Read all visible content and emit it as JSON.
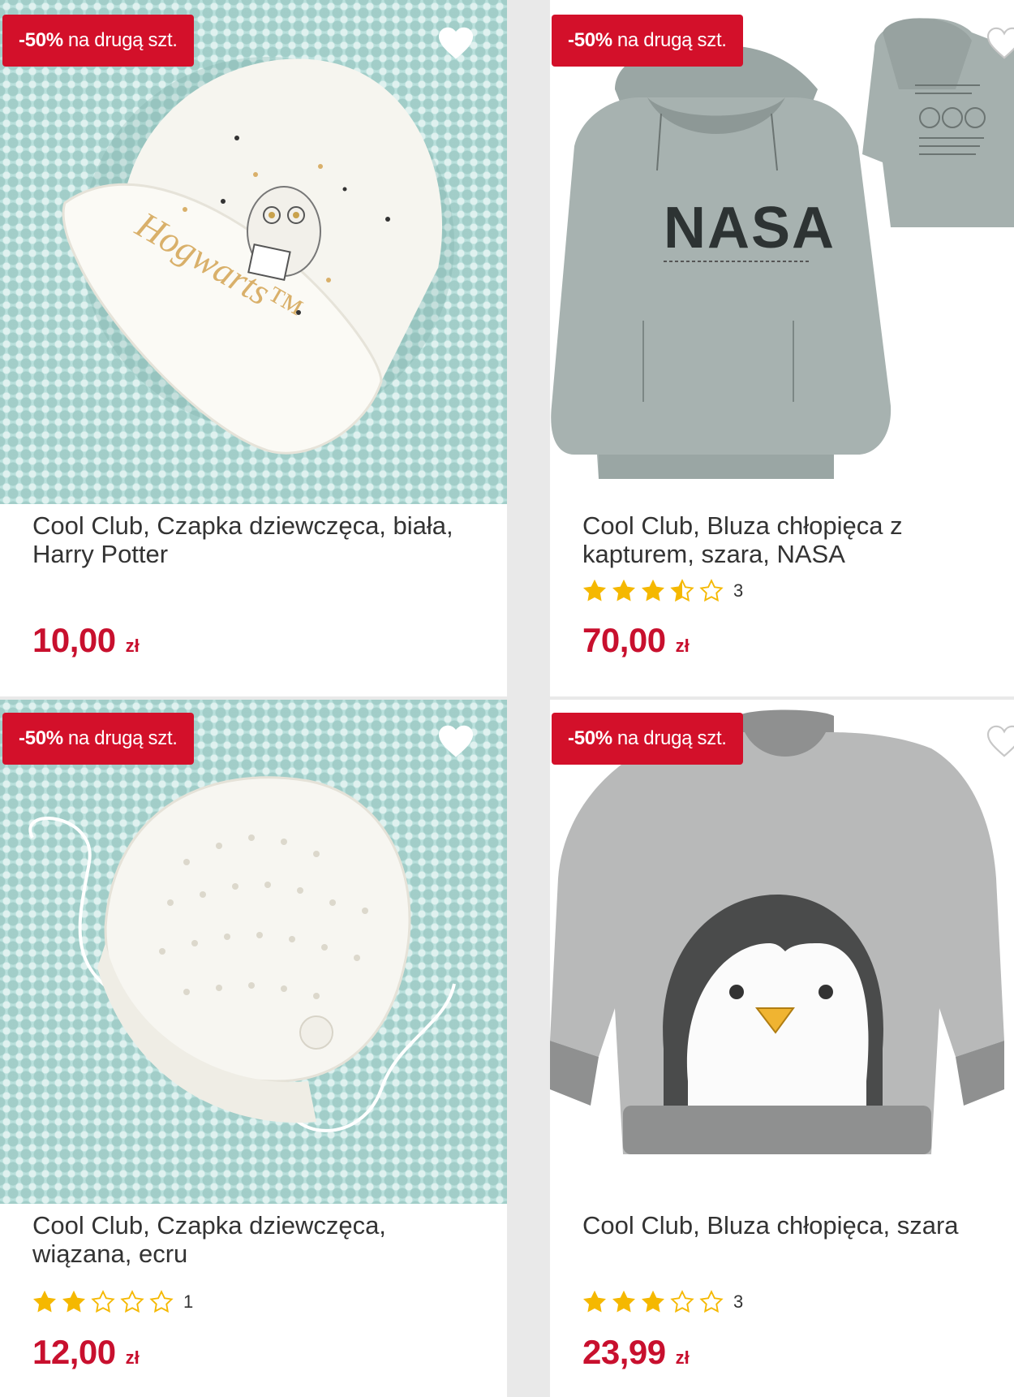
{
  "colors": {
    "accent": "#d3102a",
    "price": "#c8102e",
    "star": "#f5b800"
  },
  "products": [
    {
      "badge": {
        "pct": "-50%",
        "rest": "na drugą szt."
      },
      "title": "Cool Club, Czapka dziewczęca, biała, Harry Potter",
      "print_text": "Hogwarts™",
      "rating": null,
      "price": "10,00",
      "currency": "zł",
      "favorite_icon": "heart-icon"
    },
    {
      "badge": {
        "pct": "-50%",
        "rest": "na drugą szt."
      },
      "title": "Cool Club, Bluza chłopięca z kapturem, szara, NASA",
      "print_text": "NASA",
      "rating": {
        "stars": 3.5,
        "count": "3"
      },
      "price": "70,00",
      "currency": "zł",
      "favorite_icon": "heart-icon"
    },
    {
      "badge": {
        "pct": "-50%",
        "rest": "na drugą szt."
      },
      "title": "Cool Club, Czapka dziewczęca, wiązana, ecru",
      "rating": {
        "stars": 2,
        "count": "1"
      },
      "price": "12,00",
      "currency": "zł",
      "favorite_icon": "heart-icon"
    },
    {
      "badge": {
        "pct": "-50%",
        "rest": "na drugą szt."
      },
      "title": "Cool Club, Bluza chłopięca, szara",
      "rating": {
        "stars": 3,
        "count": "3"
      },
      "price": "23,99",
      "currency": "zł",
      "favorite_icon": "heart-icon"
    }
  ]
}
